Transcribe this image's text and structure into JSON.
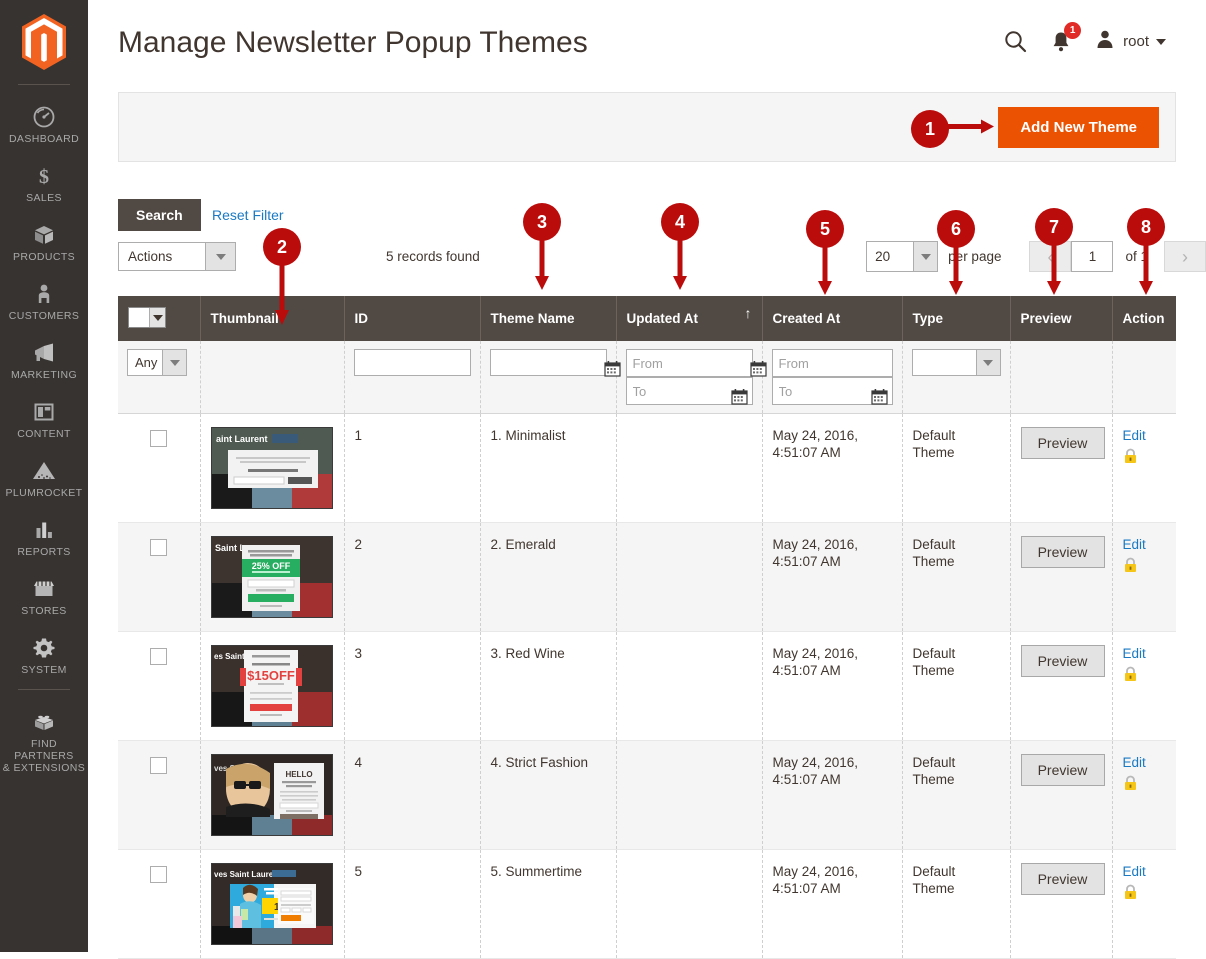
{
  "sidebar": {
    "logo_name": "magento-logo",
    "items": [
      {
        "label": "DASHBOARD",
        "icon": "dashboard-icon"
      },
      {
        "label": "SALES",
        "icon": "dollar-icon"
      },
      {
        "label": "PRODUCTS",
        "icon": "box-icon"
      },
      {
        "label": "CUSTOMERS",
        "icon": "person-icon"
      },
      {
        "label": "MARKETING",
        "icon": "megaphone-icon"
      },
      {
        "label": "CONTENT",
        "icon": "layout-icon"
      },
      {
        "label": "PLUMROCKET",
        "icon": "pyramid-icon"
      },
      {
        "label": "REPORTS",
        "icon": "bar-chart-icon"
      },
      {
        "label": "STORES",
        "icon": "storefront-icon"
      },
      {
        "label": "SYSTEM",
        "icon": "gear-icon"
      },
      {
        "label": "FIND PARTNERS\n& EXTENSIONS",
        "icon": "brick-icon"
      }
    ]
  },
  "header": {
    "title": "Manage Newsletter Popup Themes",
    "search_icon": "search-icon",
    "notifications_icon": "bell-icon",
    "notifications_count": "1",
    "user_icon": "user-avatar-icon",
    "user_name": "root"
  },
  "button_bar": {
    "add_new_theme": "Add New Theme"
  },
  "toolbar": {
    "search_label": "Search",
    "reset_filter_label": "Reset Filter",
    "massaction_label": "Actions",
    "records_found": "5 records found",
    "per_page_value": "20",
    "per_page_label": "per page",
    "page_value": "1",
    "page_of": "of 1",
    "prev_icon": "chevron-left-icon",
    "next_icon": "chevron-right-icon"
  },
  "grid": {
    "columns": [
      {
        "key": "select",
        "label": ""
      },
      {
        "key": "thumbnail",
        "label": "Thumbnail"
      },
      {
        "key": "id",
        "label": "ID"
      },
      {
        "key": "name",
        "label": "Theme Name"
      },
      {
        "key": "updated",
        "label": "Updated At",
        "sorted": "asc"
      },
      {
        "key": "created",
        "label": "Created At"
      },
      {
        "key": "type",
        "label": "Type"
      },
      {
        "key": "preview",
        "label": "Preview"
      },
      {
        "key": "action",
        "label": "Action"
      }
    ],
    "filters": {
      "select_any": "Any",
      "id_value": "",
      "name_value": "",
      "updated_from_placeholder": "From",
      "updated_to_placeholder": "To",
      "created_from_placeholder": "From",
      "created_to_placeholder": "To",
      "type_value": ""
    },
    "preview_button_label": "Preview",
    "edit_link_label": "Edit",
    "lock_icon": "lock-icon",
    "rows": [
      {
        "id": "1",
        "name": "1. Minimalist",
        "updated": "",
        "created": "May 24, 2016,\n4:51:07 AM",
        "type": "Default\nTheme",
        "thumb": "theme-thumb-minimalist"
      },
      {
        "id": "2",
        "name": "2. Emerald",
        "updated": "",
        "created": "May 24, 2016,\n4:51:07 AM",
        "type": "Default\nTheme",
        "thumb": "theme-thumb-emerald"
      },
      {
        "id": "3",
        "name": "3. Red Wine",
        "updated": "",
        "created": "May 24, 2016,\n4:51:07 AM",
        "type": "Default\nTheme",
        "thumb": "theme-thumb-redwine"
      },
      {
        "id": "4",
        "name": "4. Strict Fashion",
        "updated": "",
        "created": "May 24, 2016,\n4:51:07 AM",
        "type": "Default\nTheme",
        "thumb": "theme-thumb-strictfashion"
      },
      {
        "id": "5",
        "name": "5. Summertime",
        "updated": "",
        "created": "May 24, 2016,\n4:51:07 AM",
        "type": "Default\nTheme",
        "thumb": "theme-thumb-summertime"
      }
    ]
  },
  "annotations": [
    {
      "number": "1",
      "direction": "right"
    },
    {
      "number": "2",
      "direction": "down"
    },
    {
      "number": "3",
      "direction": "down"
    },
    {
      "number": "4",
      "direction": "down"
    },
    {
      "number": "5",
      "direction": "down"
    },
    {
      "number": "6",
      "direction": "down"
    },
    {
      "number": "7",
      "direction": "down"
    },
    {
      "number": "8",
      "direction": "down"
    }
  ],
  "colors": {
    "sidebar_bg": "#373330",
    "accent_orange": "#eb5202",
    "header_row": "#514943",
    "link_blue": "#1979c3",
    "annotation_red": "#bb0c0c",
    "badge_red": "#e02b27"
  }
}
